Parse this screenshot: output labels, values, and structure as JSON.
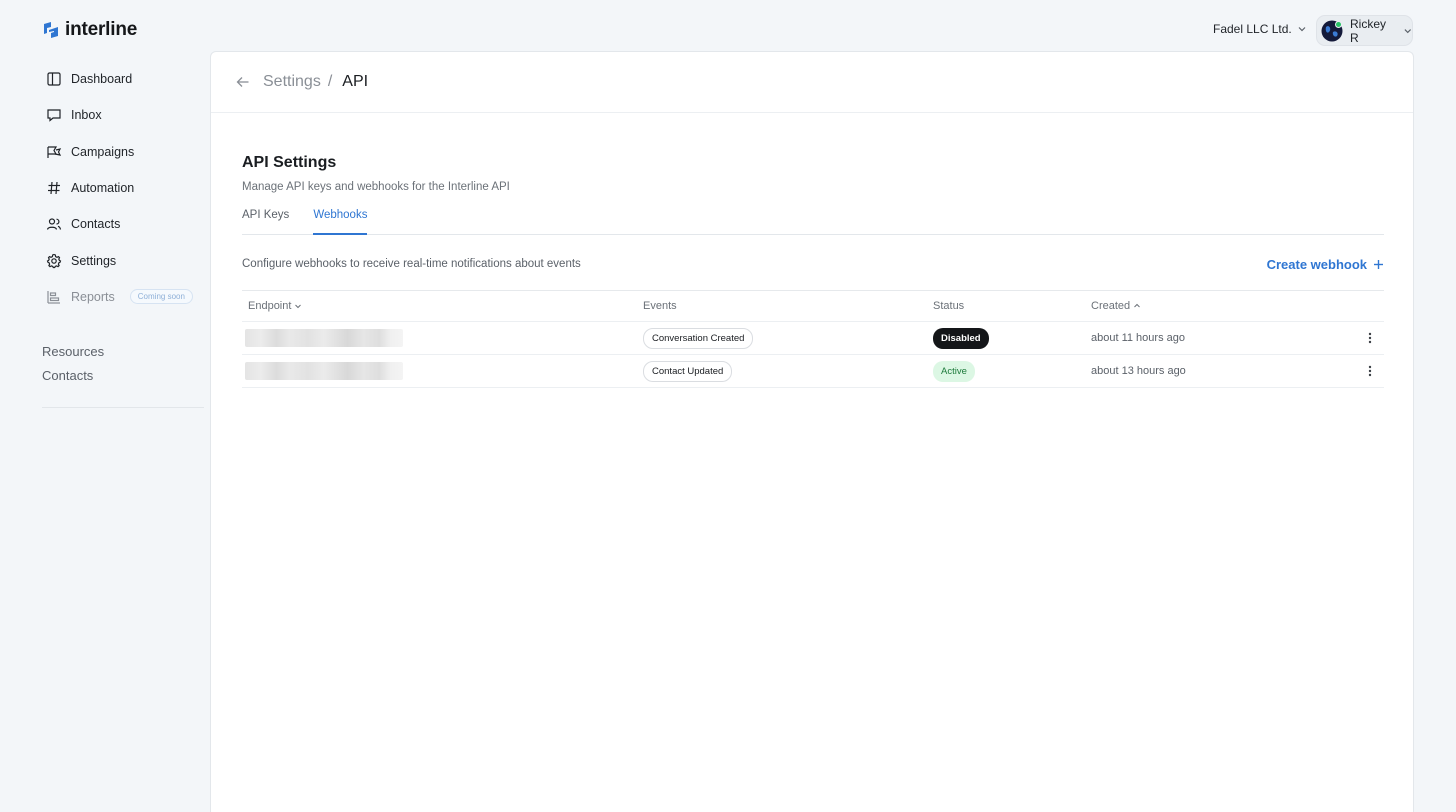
{
  "brand": {
    "name": "interline",
    "accent": "#2f76d2"
  },
  "sidebar": {
    "items": [
      {
        "label": "Dashboard",
        "icon": "dashboard-icon"
      },
      {
        "label": "Inbox",
        "icon": "inbox-icon"
      },
      {
        "label": "Campaigns",
        "icon": "campaigns-icon"
      },
      {
        "label": "Automation",
        "icon": "hash-icon"
      },
      {
        "label": "Contacts",
        "icon": "users-icon"
      },
      {
        "label": "Settings",
        "icon": "gear-icon"
      },
      {
        "label": "Reports",
        "icon": "reports-icon",
        "badge": "Coming soon",
        "disabled": true
      }
    ],
    "links": [
      "Resources",
      "Contacts"
    ]
  },
  "header": {
    "company": "Fadel LLC Ltd.",
    "user": "Rickey R"
  },
  "breadcrumb": {
    "parent": "Settings",
    "separator": "/",
    "current": "API"
  },
  "page": {
    "title": "API Settings",
    "subtitle": "Manage API keys and webhooks for the Interline API",
    "tabs": [
      {
        "label": "API Keys",
        "active": false
      },
      {
        "label": "Webhooks",
        "active": true
      }
    ],
    "toolbar_text": "Configure webhooks to receive real-time notifications about events",
    "create_button": "Create webhook",
    "create_icon": "plus-icon"
  },
  "table": {
    "columns": [
      "Endpoint",
      "Events",
      "Status",
      "Created"
    ],
    "rows": [
      {
        "endpoint_redacted": true,
        "event": "Conversation Created",
        "status": "Disabled",
        "created": "about 11 hours ago"
      },
      {
        "endpoint_redacted": true,
        "event": "Contact Updated",
        "status": "Active",
        "created": "about 13 hours ago"
      }
    ]
  }
}
